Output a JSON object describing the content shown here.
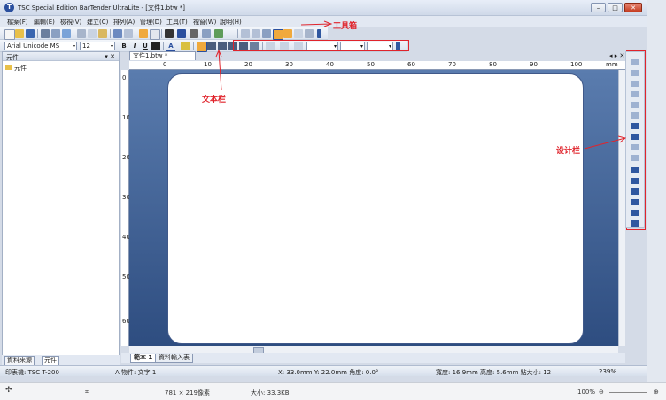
{
  "window": {
    "title": "TSC Special Edition BarTender UltraLite - [文件1.btw *]",
    "app_icon": "T",
    "minimize": "–",
    "maximize": "□",
    "close": "✕"
  },
  "menu": [
    "檔案(F)",
    "編輯(E)",
    "檢視(V)",
    "建立(C)",
    "排列(A)",
    "管理(D)",
    "工具(T)",
    "視窗(W)",
    "說明(H)"
  ],
  "format_bar": {
    "font": "Arial Unicode MS",
    "size": "12",
    "bold": "B",
    "italic": "I",
    "underline": "U",
    "color_a": "A"
  },
  "left_panel": {
    "title": "元件",
    "pin": "▾ ✕",
    "tree_item": "元件"
  },
  "document": {
    "tab": "文件1.btw *",
    "nav": "◂ ▸ ✕",
    "ruler_unit": "mm",
    "ruler_h": [
      "0",
      "10",
      "20",
      "30",
      "40",
      "50",
      "60",
      "70",
      "80",
      "90",
      "100"
    ],
    "ruler_v": [
      "0",
      "10",
      "20",
      "30",
      "40",
      "50",
      "60"
    ]
  },
  "sheet_tabs": [
    "範本 1",
    "資料輸入表"
  ],
  "bottom_tabs": [
    "資料來源",
    "元件"
  ],
  "status": {
    "printer": "印表機: TSC T-200",
    "object": "A 物件: 文字 1",
    "position": "X: 33.0mm  Y: 22.0mm  角度: 0.0°",
    "size": "寬度: 16.9mm  高度: 5.6mm  點大小: 12",
    "zoom": "239%"
  },
  "annotations": {
    "toolbox": "工具箱",
    "textbar": "文本栏",
    "designbar": "设计栏"
  },
  "viewer_bar": {
    "dimensions": "781 × 219像素",
    "filesize": "大小: 33.3KB",
    "zoom": "100%"
  },
  "colors": {
    "canvas": "#3d5f94",
    "annotation": "#e0242c"
  }
}
